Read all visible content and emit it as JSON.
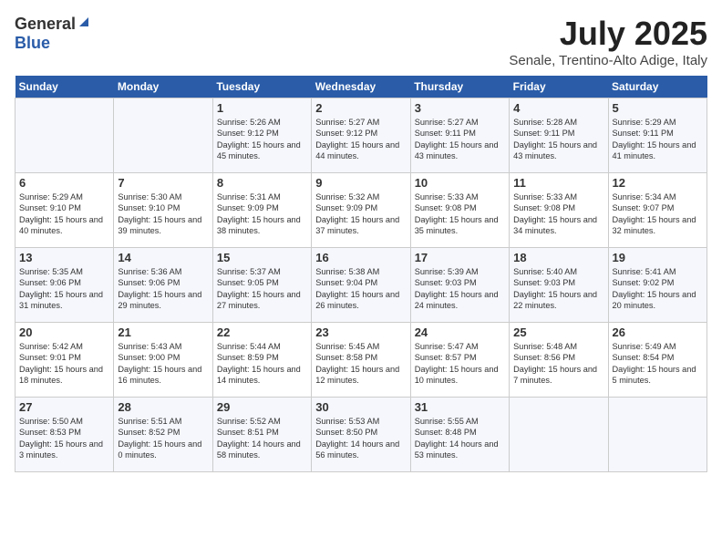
{
  "header": {
    "logo_general": "General",
    "logo_blue": "Blue",
    "month_year": "July 2025",
    "location": "Senale, Trentino-Alto Adige, Italy"
  },
  "days_of_week": [
    "Sunday",
    "Monday",
    "Tuesday",
    "Wednesday",
    "Thursday",
    "Friday",
    "Saturday"
  ],
  "weeks": [
    [
      {
        "day": "",
        "info": ""
      },
      {
        "day": "",
        "info": ""
      },
      {
        "day": "1",
        "info": "Sunrise: 5:26 AM\nSunset: 9:12 PM\nDaylight: 15 hours and 45 minutes."
      },
      {
        "day": "2",
        "info": "Sunrise: 5:27 AM\nSunset: 9:12 PM\nDaylight: 15 hours and 44 minutes."
      },
      {
        "day": "3",
        "info": "Sunrise: 5:27 AM\nSunset: 9:11 PM\nDaylight: 15 hours and 43 minutes."
      },
      {
        "day": "4",
        "info": "Sunrise: 5:28 AM\nSunset: 9:11 PM\nDaylight: 15 hours and 43 minutes."
      },
      {
        "day": "5",
        "info": "Sunrise: 5:29 AM\nSunset: 9:11 PM\nDaylight: 15 hours and 41 minutes."
      }
    ],
    [
      {
        "day": "6",
        "info": "Sunrise: 5:29 AM\nSunset: 9:10 PM\nDaylight: 15 hours and 40 minutes."
      },
      {
        "day": "7",
        "info": "Sunrise: 5:30 AM\nSunset: 9:10 PM\nDaylight: 15 hours and 39 minutes."
      },
      {
        "day": "8",
        "info": "Sunrise: 5:31 AM\nSunset: 9:09 PM\nDaylight: 15 hours and 38 minutes."
      },
      {
        "day": "9",
        "info": "Sunrise: 5:32 AM\nSunset: 9:09 PM\nDaylight: 15 hours and 37 minutes."
      },
      {
        "day": "10",
        "info": "Sunrise: 5:33 AM\nSunset: 9:08 PM\nDaylight: 15 hours and 35 minutes."
      },
      {
        "day": "11",
        "info": "Sunrise: 5:33 AM\nSunset: 9:08 PM\nDaylight: 15 hours and 34 minutes."
      },
      {
        "day": "12",
        "info": "Sunrise: 5:34 AM\nSunset: 9:07 PM\nDaylight: 15 hours and 32 minutes."
      }
    ],
    [
      {
        "day": "13",
        "info": "Sunrise: 5:35 AM\nSunset: 9:06 PM\nDaylight: 15 hours and 31 minutes."
      },
      {
        "day": "14",
        "info": "Sunrise: 5:36 AM\nSunset: 9:06 PM\nDaylight: 15 hours and 29 minutes."
      },
      {
        "day": "15",
        "info": "Sunrise: 5:37 AM\nSunset: 9:05 PM\nDaylight: 15 hours and 27 minutes."
      },
      {
        "day": "16",
        "info": "Sunrise: 5:38 AM\nSunset: 9:04 PM\nDaylight: 15 hours and 26 minutes."
      },
      {
        "day": "17",
        "info": "Sunrise: 5:39 AM\nSunset: 9:03 PM\nDaylight: 15 hours and 24 minutes."
      },
      {
        "day": "18",
        "info": "Sunrise: 5:40 AM\nSunset: 9:03 PM\nDaylight: 15 hours and 22 minutes."
      },
      {
        "day": "19",
        "info": "Sunrise: 5:41 AM\nSunset: 9:02 PM\nDaylight: 15 hours and 20 minutes."
      }
    ],
    [
      {
        "day": "20",
        "info": "Sunrise: 5:42 AM\nSunset: 9:01 PM\nDaylight: 15 hours and 18 minutes."
      },
      {
        "day": "21",
        "info": "Sunrise: 5:43 AM\nSunset: 9:00 PM\nDaylight: 15 hours and 16 minutes."
      },
      {
        "day": "22",
        "info": "Sunrise: 5:44 AM\nSunset: 8:59 PM\nDaylight: 15 hours and 14 minutes."
      },
      {
        "day": "23",
        "info": "Sunrise: 5:45 AM\nSunset: 8:58 PM\nDaylight: 15 hours and 12 minutes."
      },
      {
        "day": "24",
        "info": "Sunrise: 5:47 AM\nSunset: 8:57 PM\nDaylight: 15 hours and 10 minutes."
      },
      {
        "day": "25",
        "info": "Sunrise: 5:48 AM\nSunset: 8:56 PM\nDaylight: 15 hours and 7 minutes."
      },
      {
        "day": "26",
        "info": "Sunrise: 5:49 AM\nSunset: 8:54 PM\nDaylight: 15 hours and 5 minutes."
      }
    ],
    [
      {
        "day": "27",
        "info": "Sunrise: 5:50 AM\nSunset: 8:53 PM\nDaylight: 15 hours and 3 minutes."
      },
      {
        "day": "28",
        "info": "Sunrise: 5:51 AM\nSunset: 8:52 PM\nDaylight: 15 hours and 0 minutes."
      },
      {
        "day": "29",
        "info": "Sunrise: 5:52 AM\nSunset: 8:51 PM\nDaylight: 14 hours and 58 minutes."
      },
      {
        "day": "30",
        "info": "Sunrise: 5:53 AM\nSunset: 8:50 PM\nDaylight: 14 hours and 56 minutes."
      },
      {
        "day": "31",
        "info": "Sunrise: 5:55 AM\nSunset: 8:48 PM\nDaylight: 14 hours and 53 minutes."
      },
      {
        "day": "",
        "info": ""
      },
      {
        "day": "",
        "info": ""
      }
    ]
  ]
}
